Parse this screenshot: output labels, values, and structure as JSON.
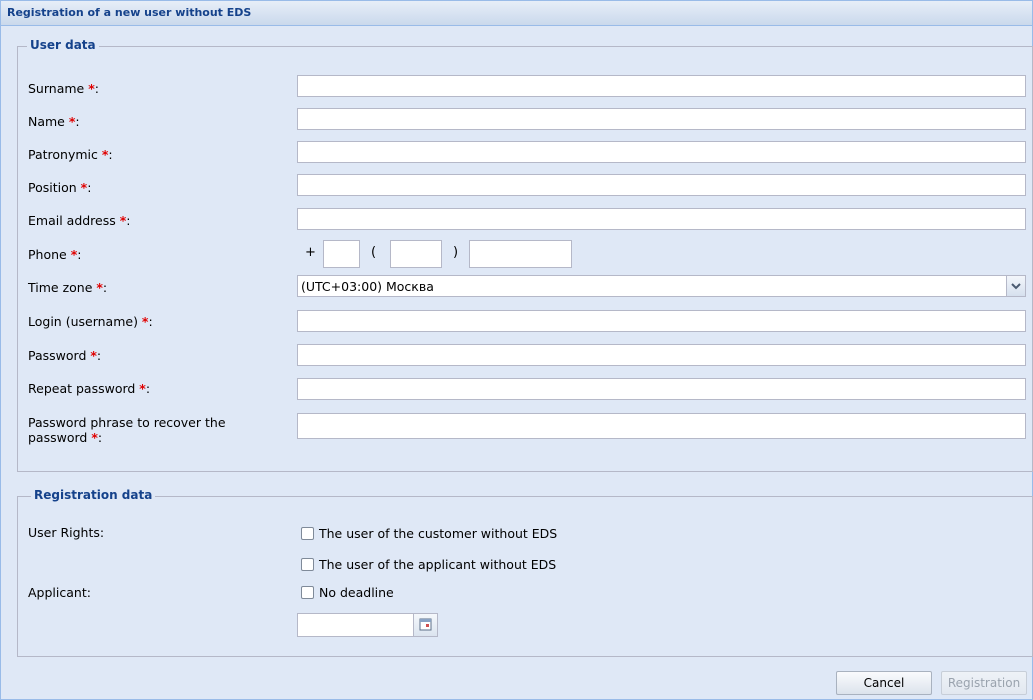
{
  "window": {
    "title": "Registration of a new user without EDS"
  },
  "user_data": {
    "legend": "User data",
    "fields": {
      "surname": {
        "label": "Surname ",
        "star": "*",
        "colon": ":"
      },
      "name": {
        "label": "Name ",
        "star": "*",
        "colon": ":"
      },
      "patronymic": {
        "label": "Patronymic ",
        "star": "*",
        "colon": ":"
      },
      "position": {
        "label": "Position ",
        "star": "*",
        "colon": ":"
      },
      "email": {
        "label": "Email address ",
        "star": "*",
        "colon": ":"
      },
      "phone": {
        "label": "Phone ",
        "star": "*",
        "colon": ":",
        "plus": "+",
        "open_paren": "(",
        "close_paren": ")"
      },
      "timezone": {
        "label": "Time zone ",
        "star": "*",
        "colon": ":",
        "value": "(UTC+03:00) Москва"
      },
      "login": {
        "label": "Login (username) ",
        "star": "*",
        "colon": ":"
      },
      "password": {
        "label": "Password ",
        "star": "*",
        "colon": ":"
      },
      "repeat_password": {
        "label": "Repeat password ",
        "star": "*",
        "colon": ":"
      },
      "phrase": {
        "label_line1": "Password phrase to recover the",
        "label_line2": "password ",
        "star": "*",
        "colon": ":"
      }
    }
  },
  "registration_data": {
    "legend": "Registration data",
    "user_rights_label": "User Rights:",
    "right_customer": "The user of the customer without EDS",
    "right_applicant": "The user of the applicant without EDS",
    "applicant_label": "Applicant:",
    "no_deadline": "No deadline"
  },
  "buttons": {
    "cancel": "Cancel",
    "registration": "Registration"
  }
}
